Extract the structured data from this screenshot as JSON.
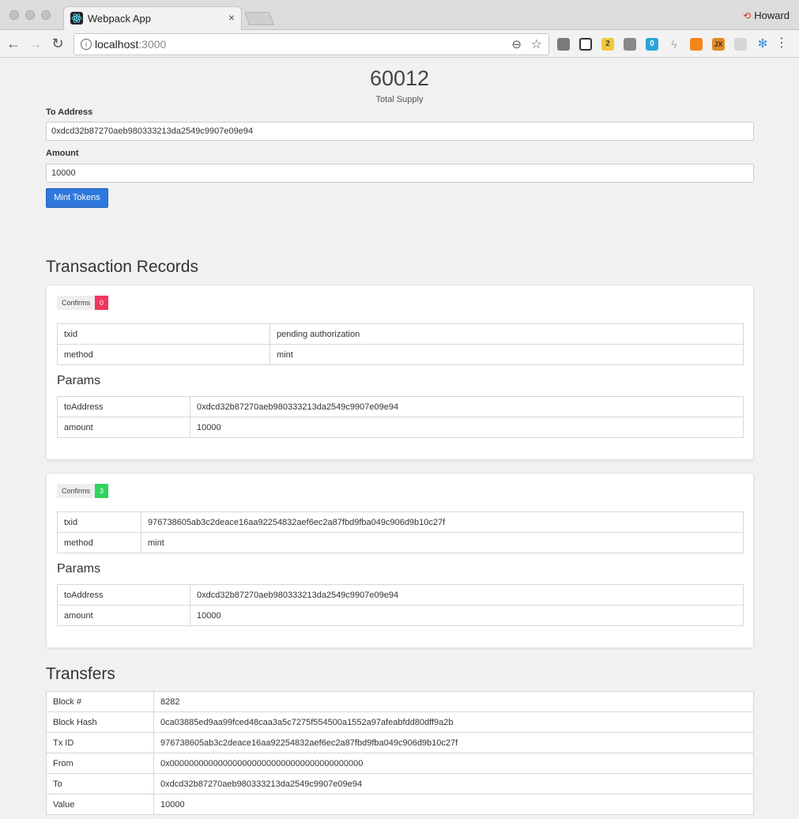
{
  "browser": {
    "tab_title": "Webpack App",
    "tab_close": "×",
    "profile_name": "Howard",
    "url_host": "localhost",
    "url_port": ":3000",
    "extensions": [
      {
        "name": "pocket-icon",
        "badge": ""
      },
      {
        "name": "qr-code-icon",
        "badge": ""
      },
      {
        "name": "extension-yellow-icon",
        "badge": "2"
      },
      {
        "name": "ublock-icon",
        "badge": ""
      },
      {
        "name": "ghostery-icon",
        "badge": "0"
      },
      {
        "name": "lightning-icon",
        "badge": ""
      },
      {
        "name": "metamask-icon",
        "badge": ""
      },
      {
        "name": "jx-icon",
        "badge": "JX"
      },
      {
        "name": "shield-icon",
        "badge": ""
      },
      {
        "name": "pinwheel-icon",
        "badge": ""
      }
    ]
  },
  "supply": {
    "value": "60012",
    "label": "Total Supply"
  },
  "mint_form": {
    "to_label": "To Address",
    "to_value": "0xdcd32b87270aeb980333213da2549c9907e09e94",
    "amount_label": "Amount",
    "amount_value": "10000",
    "button_label": "Mint Tokens"
  },
  "transactions": {
    "title": "Transaction Records",
    "params_title": "Params",
    "records": [
      {
        "confirms_label": "Confirms",
        "confirms_count": "0",
        "confirms_color": "#f0355d",
        "txid_label": "txid",
        "txid_value": "pending authorization",
        "method_label": "method",
        "method_value": "mint",
        "to_label": "toAddress",
        "to_value": "0xdcd32b87270aeb980333213da2549c9907e09e94",
        "amount_label": "amount",
        "amount_value": "10000"
      },
      {
        "confirms_label": "Confirms",
        "confirms_count": "3",
        "confirms_color": "#2fd35a",
        "txid_label": "txid",
        "txid_value": "976738605ab3c2deace16aa92254832aef6ec2a87fbd9fba049c906d9b10c27f",
        "method_label": "method",
        "method_value": "mint",
        "to_label": "toAddress",
        "to_value": "0xdcd32b87270aeb980333213da2549c9907e09e94",
        "amount_label": "amount",
        "amount_value": "10000"
      }
    ]
  },
  "transfers": {
    "title": "Transfers",
    "rows": [
      {
        "label": "Block #",
        "value": "8282"
      },
      {
        "label": "Block Hash",
        "value": "0ca03885ed9aa99fced48caa3a5c7275f554500a1552a97afeabfdd80dff9a2b"
      },
      {
        "label": "Tx ID",
        "value": "976738605ab3c2deace16aa92254832aef6ec2a87fbd9fba049c906d9b10c27f"
      },
      {
        "label": "From",
        "value": "0x0000000000000000000000000000000000000000"
      },
      {
        "label": "To",
        "value": "0xdcd32b87270aeb980333213da2549c9907e09e94"
      },
      {
        "label": "Value",
        "value": "10000"
      }
    ]
  }
}
